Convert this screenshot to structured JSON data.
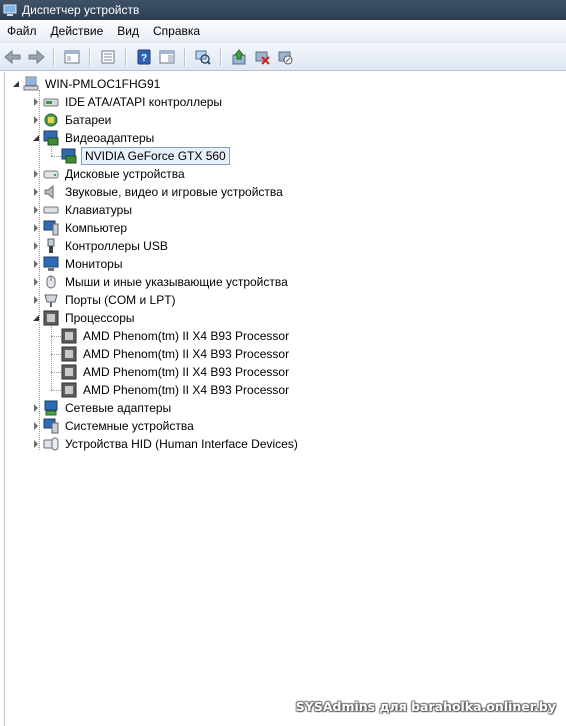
{
  "window": {
    "title": "Диспетчер устройств"
  },
  "menu": [
    "Файл",
    "Действие",
    "Вид",
    "Справка"
  ],
  "toolbar": {
    "buttons": [
      "back-arrow-icon",
      "forward-arrow-icon",
      "properties-panel-icon",
      "console-tree-icon",
      "help-icon",
      "action-pane-icon",
      "scan-hardware-icon",
      "update-driver-icon",
      "disable-device-icon",
      "uninstall-device-icon"
    ]
  },
  "tree": {
    "root": "WIN-PMLOC1FHG91",
    "items": [
      {
        "label": "IDE ATA/ATAPI контроллеры",
        "expanded": false
      },
      {
        "label": "Батареи",
        "expanded": false
      },
      {
        "label": "Видеоадаптеры",
        "expanded": true,
        "children": [
          "NVIDIA GeForce GTX 560"
        ]
      },
      {
        "label": "Дисковые устройства",
        "expanded": false
      },
      {
        "label": "Звуковые, видео и игровые устройства",
        "expanded": false
      },
      {
        "label": "Клавиатуры",
        "expanded": false
      },
      {
        "label": "Компьютер",
        "expanded": false
      },
      {
        "label": "Контроллеры USB",
        "expanded": false
      },
      {
        "label": "Мониторы",
        "expanded": false
      },
      {
        "label": "Мыши и иные указывающие устройства",
        "expanded": false
      },
      {
        "label": "Порты (COM и LPT)",
        "expanded": false
      },
      {
        "label": "Процессоры",
        "expanded": true,
        "children": [
          "AMD Phenom(tm) II X4 B93 Processor",
          "AMD Phenom(tm) II X4 B93 Processor",
          "AMD Phenom(tm) II X4 B93 Processor",
          "AMD Phenom(tm) II X4 B93 Processor"
        ]
      },
      {
        "label": "Сетевые адаптеры",
        "expanded": false
      },
      {
        "label": "Системные устройства",
        "expanded": false
      },
      {
        "label": "Устройства HID (Human Interface Devices)",
        "expanded": false
      }
    ],
    "selected": "NVIDIA GeForce GTX 560"
  },
  "watermark": "SYSAdmins для baraholka.onliner.by",
  "colors": {
    "titlebar": "#2c3d51",
    "selection_border": "#7da2ce",
    "selection_fill": "#e8f1fb"
  }
}
